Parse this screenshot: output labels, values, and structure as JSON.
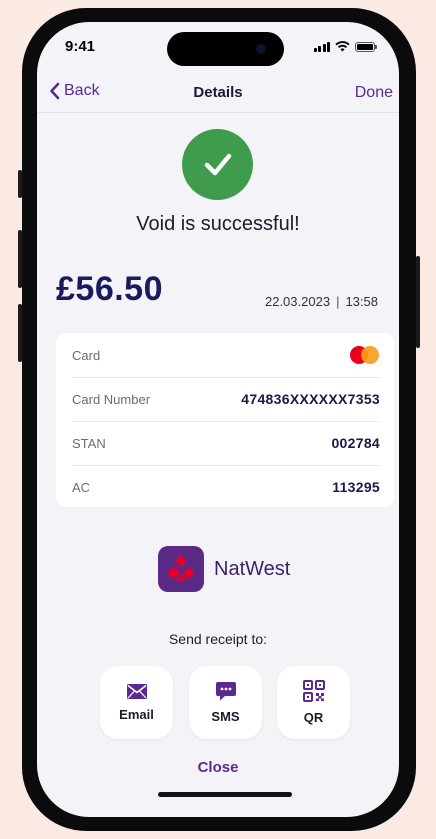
{
  "status_bar": {
    "time": "9:41"
  },
  "nav": {
    "back_label": "Back",
    "title": "Details",
    "done_label": "Done"
  },
  "result": {
    "message": "Void is successful!"
  },
  "transaction": {
    "amount": "£56.50",
    "date": "22.03.2023",
    "separator": "|",
    "time": "13:58"
  },
  "details": {
    "rows": [
      {
        "label": "Card",
        "value": ""
      },
      {
        "label": "Card Number",
        "value": "474836XXXXXX7353"
      },
      {
        "label": "STAN",
        "value": "002784"
      },
      {
        "label": "AC",
        "value": "113295"
      }
    ],
    "card_brand_icon": "mastercard-icon"
  },
  "bank": {
    "name": "NatWest",
    "logo_icon": "natwest-logo"
  },
  "receipt": {
    "prompt": "Send receipt to:",
    "options": [
      {
        "label": "Email",
        "icon": "envelope-icon"
      },
      {
        "label": "SMS",
        "icon": "chat-bubble-icon"
      },
      {
        "label": "QR",
        "icon": "qr-code-icon"
      }
    ]
  },
  "close_label": "Close",
  "colors": {
    "accent": "#5a2a92",
    "success": "#3f9c4c",
    "amount": "#1a1a5e",
    "background": "#f4f3f8",
    "page_background": "#fbe9e4"
  }
}
